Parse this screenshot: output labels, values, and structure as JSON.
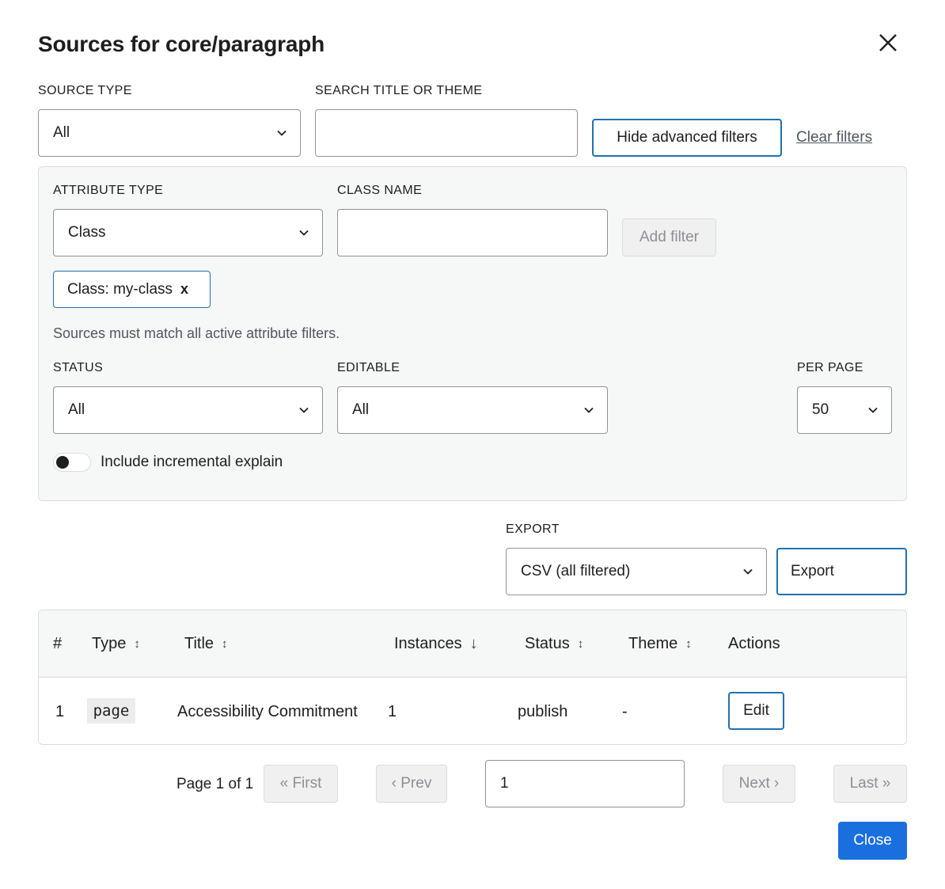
{
  "modal": {
    "title": "Sources for core/paragraph"
  },
  "filters": {
    "source_type_label": "SOURCE TYPE",
    "source_type_value": "All",
    "search_label": "SEARCH TITLE OR THEME",
    "search_value": "",
    "hide_advanced_label": "Hide advanced filters",
    "clear_filters_label": "Clear filters"
  },
  "advanced": {
    "attribute_type_label": "ATTRIBUTE TYPE",
    "attribute_type_value": "Class",
    "class_name_label": "CLASS NAME",
    "class_name_value": "",
    "add_filter_label": "Add filter",
    "chip_label": "Class: my-class",
    "chip_remove": "x",
    "hint": "Sources must match all active attribute filters.",
    "status_label": "STATUS",
    "status_value": "All",
    "editable_label": "EDITABLE",
    "editable_value": "All",
    "per_page_label": "PER PAGE",
    "per_page_value": "50",
    "toggle_label": "Include incremental explain",
    "toggle_on": false
  },
  "export": {
    "label": "EXPORT",
    "format_value": "CSV (all filtered)",
    "button_label": "Export"
  },
  "table": {
    "columns": [
      "#",
      "Type",
      "Title",
      "Instances",
      "Status",
      "Theme",
      "Actions"
    ],
    "sort_updown": "↕",
    "sort_down": "↓",
    "rows": [
      {
        "num": "1",
        "type": "page",
        "title": "Accessibility Commitment",
        "instances": "1",
        "status": "publish",
        "theme": "-",
        "action": "Edit"
      }
    ]
  },
  "pagination": {
    "page_text": "Page 1 of 1",
    "first": "« First",
    "prev": "‹ Prev",
    "page_input": "1",
    "next": "Next ›",
    "last": "Last »"
  },
  "footer": {
    "close_label": "Close"
  },
  "colors": {
    "accent": "#2271b1",
    "primary_button": "#1a6fde",
    "panel_bg": "#f6f7f7"
  }
}
